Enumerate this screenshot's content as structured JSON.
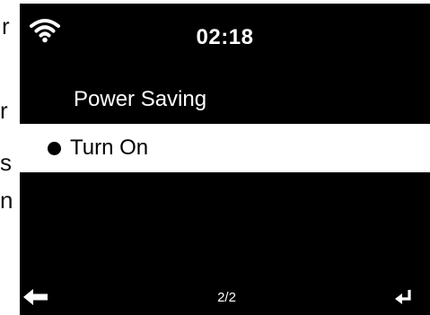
{
  "edge_text": [
    "r",
    "r",
    "s",
    "n"
  ],
  "status_bar": {
    "wifi_icon": "wifi-icon",
    "time": "02:18"
  },
  "menu": {
    "title": "Power Saving",
    "items": [
      {
        "label": "Turn On",
        "selected": true,
        "bullet": "filled-circle"
      }
    ]
  },
  "footer": {
    "back_icon": "left-arrow-icon",
    "page_indicator": "2/2",
    "enter_icon": "enter-icon"
  },
  "colors": {
    "screen_bg": "#000000",
    "text": "#ffffff",
    "highlight_bg": "#ffffff",
    "highlight_text": "#000000"
  }
}
